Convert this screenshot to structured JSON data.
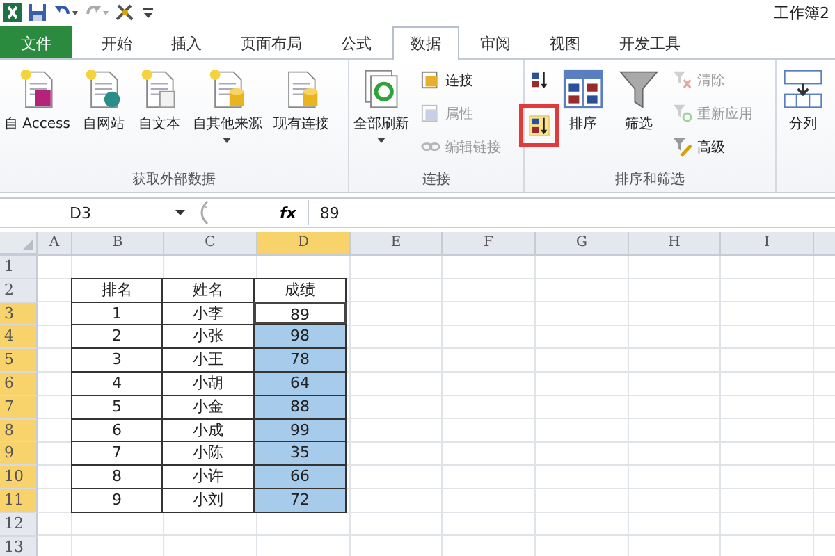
{
  "window": {
    "title": "工作簿2"
  },
  "tabs": [
    {
      "label": "文件",
      "kind": "file",
      "selected": false
    },
    {
      "label": "开始",
      "kind": "tab",
      "selected": false
    },
    {
      "label": "插入",
      "kind": "tab",
      "selected": false
    },
    {
      "label": "页面布局",
      "kind": "tab",
      "selected": false
    },
    {
      "label": "公式",
      "kind": "tab",
      "selected": false
    },
    {
      "label": "数据",
      "kind": "tab",
      "selected": true
    },
    {
      "label": "审阅",
      "kind": "tab",
      "selected": false
    },
    {
      "label": "视图",
      "kind": "tab",
      "selected": false
    },
    {
      "label": "开发工具",
      "kind": "tab",
      "selected": false
    }
  ],
  "ribbon": {
    "groups": [
      {
        "label": "获取外部数据",
        "columns": [
          {
            "kind": "large",
            "buttons": [
              {
                "label": "自 Access",
                "disabled": false,
                "highlighted": false,
                "has_menu": false
              }
            ]
          },
          {
            "kind": "large",
            "buttons": [
              {
                "label": "自网站",
                "disabled": false,
                "highlighted": false,
                "has_menu": false
              }
            ]
          },
          {
            "kind": "large",
            "buttons": [
              {
                "label": "自文本",
                "disabled": false,
                "highlighted": false,
                "has_menu": false
              }
            ]
          },
          {
            "kind": "large",
            "buttons": [
              {
                "label": "自其他来源",
                "disabled": false,
                "highlighted": false,
                "has_menu": true
              }
            ]
          },
          {
            "kind": "large",
            "buttons": [
              {
                "label": "现有连接",
                "disabled": false,
                "highlighted": false,
                "has_menu": false
              }
            ]
          }
        ]
      },
      {
        "label": "连接",
        "columns": [
          {
            "kind": "large",
            "buttons": [
              {
                "label": "全部刷新",
                "disabled": false,
                "highlighted": false,
                "has_menu": true
              }
            ]
          },
          {
            "kind": "small",
            "buttons": [
              {
                "label": "连接",
                "disabled": false,
                "highlighted": false
              },
              {
                "label": "属性",
                "disabled": true,
                "highlighted": false
              },
              {
                "label": "编辑链接",
                "disabled": true,
                "highlighted": false
              }
            ]
          }
        ]
      },
      {
        "label": "排序和筛选",
        "columns": [
          {
            "kind": "icon",
            "buttons": [
              {
                "disabled": false,
                "highlighted": false
              },
              {
                "disabled": false,
                "highlighted": true
              }
            ]
          },
          {
            "kind": "large",
            "buttons": [
              {
                "label": "排序",
                "disabled": false,
                "highlighted": false,
                "has_menu": false
              }
            ]
          },
          {
            "kind": "large",
            "buttons": [
              {
                "label": "筛选",
                "disabled": false,
                "highlighted": false,
                "has_menu": false
              }
            ]
          },
          {
            "kind": "small",
            "buttons": [
              {
                "label": "清除",
                "disabled": true,
                "highlighted": false
              },
              {
                "label": "重新应用",
                "disabled": true,
                "highlighted": false
              },
              {
                "label": "高级",
                "disabled": false,
                "highlighted": false
              }
            ]
          }
        ]
      },
      {
        "columns": [
          {
            "kind": "large",
            "buttons": [
              {
                "label": "分列",
                "disabled": false,
                "highlighted": false,
                "has_menu": false
              }
            ]
          }
        ]
      }
    ]
  },
  "formula_bar": {
    "name_box": "D3",
    "function_label": "fx",
    "value": "89"
  },
  "sheet": {
    "columns": [
      {
        "label": "A",
        "selected": false
      },
      {
        "label": "B",
        "selected": false
      },
      {
        "label": "C",
        "selected": false
      },
      {
        "label": "D",
        "selected": true
      },
      {
        "label": "E",
        "selected": false
      },
      {
        "label": "F",
        "selected": false
      },
      {
        "label": "G",
        "selected": false
      },
      {
        "label": "H",
        "selected": false
      },
      {
        "label": "I",
        "selected": false
      }
    ],
    "rows": [
      {
        "label": "1",
        "selected": false
      },
      {
        "label": "2",
        "selected": false,
        "values": [
          "排名",
          "姓名",
          "成绩"
        ]
      },
      {
        "label": "3",
        "selected": true,
        "active": true,
        "values": [
          "1",
          "小李",
          "89"
        ]
      },
      {
        "label": "4",
        "selected": true,
        "active": false,
        "values": [
          "2",
          "小张",
          "98"
        ]
      },
      {
        "label": "5",
        "selected": true,
        "active": false,
        "values": [
          "3",
          "小王",
          "78"
        ]
      },
      {
        "label": "6",
        "selected": true,
        "active": false,
        "values": [
          "4",
          "小胡",
          "64"
        ]
      },
      {
        "label": "7",
        "selected": true,
        "active": false,
        "values": [
          "5",
          "小金",
          "88"
        ]
      },
      {
        "label": "8",
        "selected": true,
        "active": false,
        "values": [
          "6",
          "小成",
          "99"
        ]
      },
      {
        "label": "9",
        "selected": true,
        "active": false,
        "values": [
          "7",
          "小陈",
          "35"
        ]
      },
      {
        "label": "10",
        "selected": true,
        "active": false,
        "values": [
          "8",
          "小许",
          "66"
        ]
      },
      {
        "label": "11",
        "selected": true,
        "active": false,
        "values": [
          "9",
          "小刘",
          "72"
        ]
      },
      {
        "label": "12",
        "selected": false
      },
      {
        "label": "13",
        "selected": false
      }
    ]
  }
}
